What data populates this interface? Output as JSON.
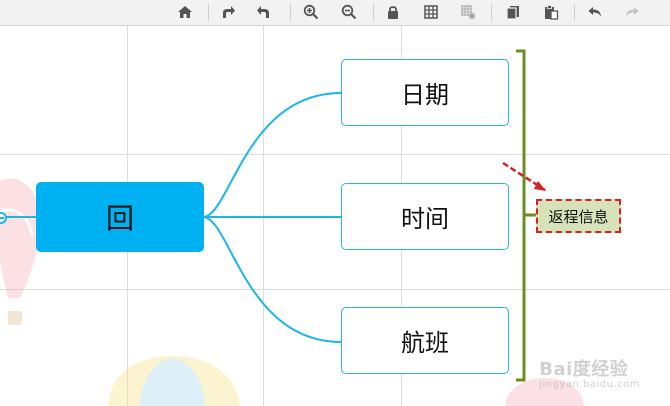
{
  "toolbar": {
    "buttons": [
      {
        "name": "home-icon"
      },
      {
        "name": "redo-layout-icon"
      },
      {
        "name": "undo-layout-icon"
      },
      {
        "name": "zoom-in-icon"
      },
      {
        "name": "zoom-out-icon"
      },
      {
        "name": "lock-icon"
      },
      {
        "name": "grid-icon"
      },
      {
        "name": "grid-settings-icon"
      },
      {
        "name": "copy-icon"
      },
      {
        "name": "paste-icon"
      },
      {
        "name": "undo-icon"
      },
      {
        "name": "redo-icon"
      }
    ]
  },
  "mindmap": {
    "root": {
      "label": "回"
    },
    "children": [
      {
        "label": "日期"
      },
      {
        "label": "时间"
      },
      {
        "label": "航班"
      }
    ],
    "summary": {
      "label": "返程信息"
    }
  },
  "watermark": {
    "text": "Bai度经验",
    "sub": "jingyan.baidu.com"
  },
  "colors": {
    "root_fill": "#00b1f2",
    "branch_line": "#1bb5e8",
    "bracket": "#6b8e23",
    "summary_fill": "#d7e2b9",
    "summary_border": "#d61f26"
  }
}
